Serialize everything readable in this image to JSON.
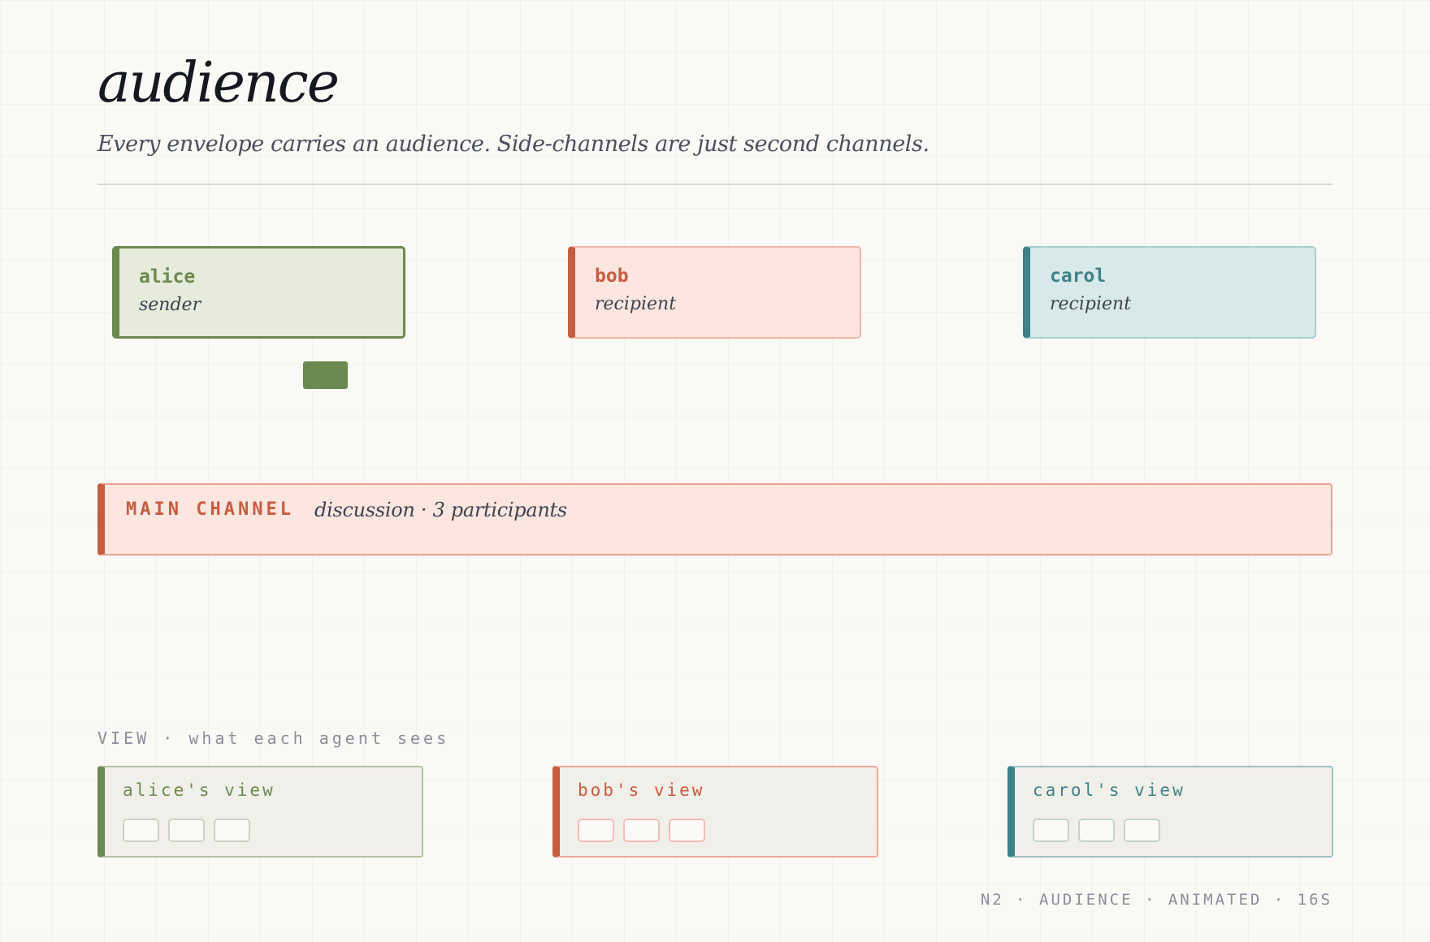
{
  "header": {
    "title": "audience",
    "subtitle": "Every envelope carries an audience. Side-channels are just second channels."
  },
  "colors": {
    "alice": "#6a8a50",
    "bob": "#c75c40",
    "carol": "#3f8288",
    "background": "#fbf9f5"
  },
  "agents": [
    {
      "name": "alice",
      "role": "sender"
    },
    {
      "name": "bob",
      "role": "recipient"
    },
    {
      "name": "carol",
      "role": "recipient"
    }
  ],
  "channel": {
    "label": "MAIN CHANNEL",
    "description": "discussion · 3 participants"
  },
  "views": {
    "section_label": "VIEW · what each agent sees",
    "items": [
      {
        "title": "alice's view",
        "slots": 3
      },
      {
        "title": "bob's view",
        "slots": 3
      },
      {
        "title": "carol's view",
        "slots": 3
      }
    ]
  },
  "footer": {
    "caption": "N2 · AUDIENCE · ANIMATED · 16S"
  }
}
